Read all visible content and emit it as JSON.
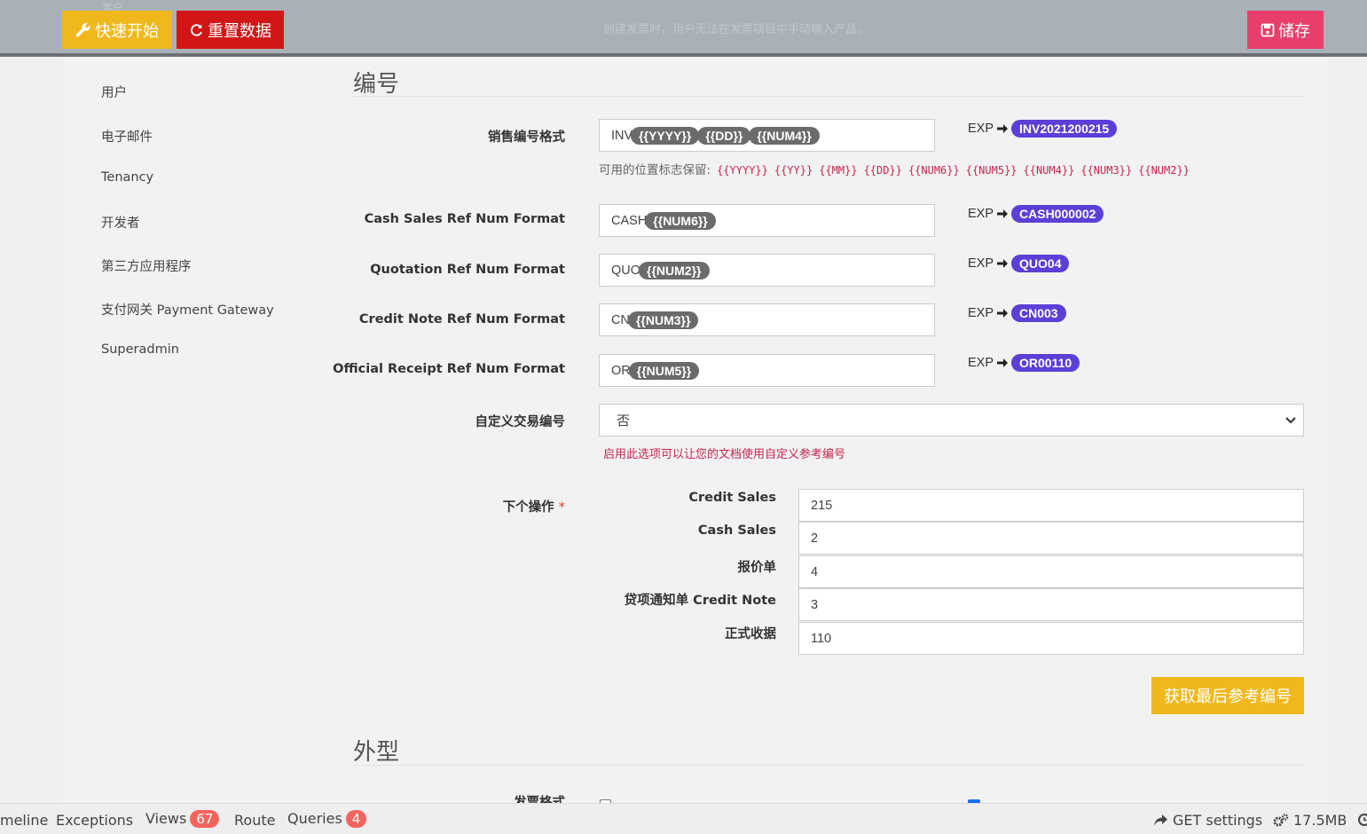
{
  "topbar": {
    "ghost_top": "客户",
    "ghost_text": "创建发票时，用户无法在发票项目中手动输入产品。",
    "quick_start_label": "快速开始",
    "reset_label": "重置数据",
    "save_label": "储存"
  },
  "sidebar": {
    "items": [
      {
        "label": "用户"
      },
      {
        "label": "电子邮件"
      },
      {
        "label": "Tenancy"
      },
      {
        "label": "开发者"
      },
      {
        "label": "第三方应用程序"
      },
      {
        "label": "支付网关 Payment Gateway"
      },
      {
        "label": "Superadmin"
      }
    ]
  },
  "numbering": {
    "title": "编号",
    "formats": [
      {
        "label": "销售编号格式",
        "prefix": "INV",
        "tags": [
          "{{YYYY}}",
          "{{DD}}",
          "{{NUM4}}"
        ],
        "exp": "EXP",
        "example": "INV2021200215"
      },
      {
        "label": "Cash Sales Ref Num Format",
        "prefix": "CASH",
        "tags": [
          "{{NUM6}}"
        ],
        "exp": "EXP",
        "example": "CASH000002"
      },
      {
        "label": "Quotation Ref Num Format",
        "prefix": "QUO",
        "tags": [
          "{{NUM2}}"
        ],
        "exp": "EXP",
        "example": "QUO04"
      },
      {
        "label": "Credit Note Ref Num Format",
        "prefix": "CN",
        "tags": [
          "{{NUM3}}"
        ],
        "exp": "EXP",
        "example": "CN003"
      },
      {
        "label": "Official Receipt Ref Num Format",
        "prefix": "OR",
        "tags": [
          "{{NUM5}}"
        ],
        "exp": "EXP",
        "example": "OR00110"
      }
    ],
    "hint_label": "可用的位置标志保留:",
    "placeholders": [
      "{{YYYY}}",
      "{{YY}}",
      "{{MM}}",
      "{{DD}}",
      "{{NUM6}}",
      "{{NUM5}}",
      "{{NUM4}}",
      "{{NUM3}}",
      "{{NUM2}}"
    ],
    "custom_label": "自定义交易编号",
    "custom_value": "否",
    "custom_help": "启用此选项可以让您的文档使用自定义参考编号",
    "next_label": "下个操作",
    "required_mark": "*",
    "next_items": [
      {
        "label": "Credit Sales",
        "value": "215"
      },
      {
        "label": "Cash Sales",
        "value": "2"
      },
      {
        "label": "报价单",
        "value": "4"
      },
      {
        "label": "贷项通知单 Credit Note",
        "value": "3"
      },
      {
        "label": "正式收据",
        "value": "110"
      }
    ],
    "fetch_label": "获取最后参考编号"
  },
  "appearance": {
    "title": "外型",
    "partial_label": "发票格式"
  },
  "debugbar": {
    "timeline": "meline",
    "exceptions": "Exceptions",
    "views": "Views",
    "views_count": "67",
    "route": "Route",
    "queries": "Queries",
    "queries_count": "4",
    "request": "GET settings",
    "memory": "17.5MB"
  },
  "colors": {
    "accent_yellow": "#f0b81d",
    "danger_red": "#d01616",
    "save_pink": "#e83e6b",
    "exp_badge": "#5b3fd6",
    "tag_gray": "#6b6b6b"
  }
}
